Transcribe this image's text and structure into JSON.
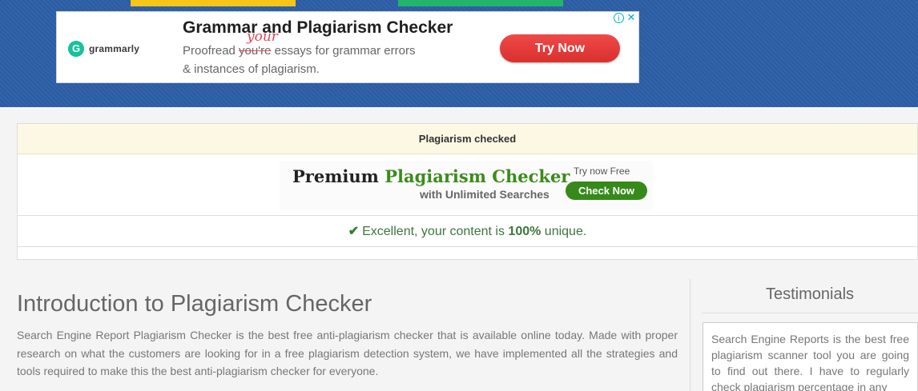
{
  "ad": {
    "brand": "grammarly",
    "title": "Grammar and Plagiarism Checker",
    "handwritten_fix": "your",
    "line1_prefix": "Proofread ",
    "line1_struck": "you're",
    "line1_suffix": " essays for grammar errors",
    "line2": "& instances of plagiarism.",
    "cta": "Try Now",
    "info": "i",
    "close": "✕"
  },
  "result": {
    "header": "Plagiarism checked",
    "promo": {
      "title_part1": "Premium ",
      "title_part2": "Plagiarism Checker",
      "subtitle": "with Unlimited Searches",
      "try_text": "Try now Free",
      "cta": "Check Now"
    },
    "message_prefix": "Excellent, your content is ",
    "message_value": "100%",
    "message_suffix": " unique."
  },
  "intro": {
    "title": "Introduction to Plagiarism Checker",
    "body": "Search Engine Report Plagiarism Checker is the best free anti-plagiarism checker that is available online today. Made with proper research on what the customers are looking for in a free plagiarism detection system, we have implemented all the strategies and tools required to make this the best anti-plagiarism checker for everyone."
  },
  "testimonials": {
    "title": "Testimonials",
    "text": "Search Engine Reports is the best free plagiarism scanner tool you are going to find out there. I have to regularly check plagiarism percentage in any"
  },
  "colors": {
    "header_bg": "#2c5fa6",
    "nav_yellow": "#f7c518",
    "nav_green": "#23b46b",
    "ad_cta": "#e03b3b",
    "promo_green": "#368a1a",
    "success_text": "#3c763d",
    "alert_bg": "#fcf8e3"
  },
  "icons": {
    "grammarly_logo": "grammarly-logo-icon",
    "adchoices": "info-icon",
    "close": "close-icon",
    "success": "checkmark-icon"
  }
}
